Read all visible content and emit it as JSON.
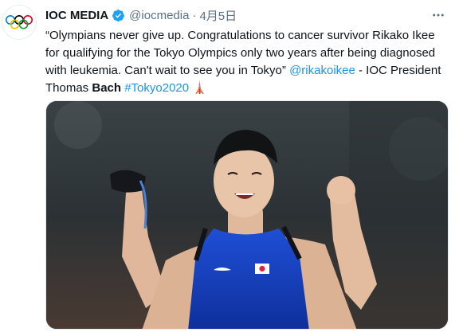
{
  "tweet": {
    "author_name": "IOC MEDIA",
    "handle": "@iocmedia",
    "separator": "·",
    "date": "4月5日",
    "text": {
      "part1": "“Olympians never give up. Congratulations to cancer survivor Rikako Ikee for qualifying for the Tokyo Olympics only two years after being diagnosed with leukemia. Can't wait to see you in Tokyo” ",
      "mention": "@rikakoikee",
      "part2": " - IOC President Thomas ",
      "bold": "Bach",
      "space": " ",
      "hashtag": "#Tokyo2020",
      "emoji": "🗼"
    },
    "icons": {
      "avatar": "olympic-rings-icon",
      "verified": "verified-badge-icon",
      "more": "more-options-icon"
    },
    "colors": {
      "text": "#0f1419",
      "secondary": "#5b7083",
      "link": "#1b95e0",
      "verified": "#1da1f2"
    }
  }
}
